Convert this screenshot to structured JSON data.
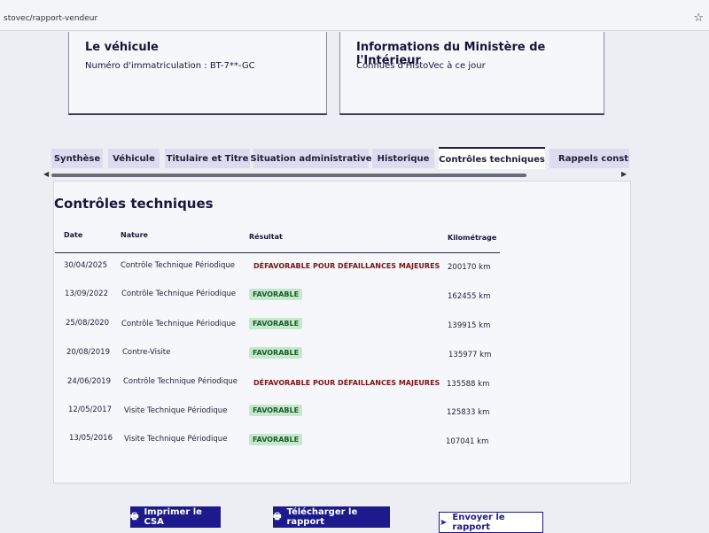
{
  "browser": {
    "url": "stovec/rapport-vendeur",
    "star_icon": "star-icon"
  },
  "vehicle_card": {
    "title": "Le véhicule",
    "text": "Numéro d'immatriculation : BT-7**-GC"
  },
  "ministry_card": {
    "title": "Informations du Ministère de l'Intérieur",
    "text": "Connues d'HistoVec à ce jour"
  },
  "tabs": [
    {
      "label": "Synthèse"
    },
    {
      "label": "Véhicule"
    },
    {
      "label": "Titulaire et Titre"
    },
    {
      "label": "Situation administrative"
    },
    {
      "label": "Historique"
    },
    {
      "label": "Contrôles techniques",
      "active": true
    },
    {
      "label": "Rappels constructeur"
    }
  ],
  "section": {
    "title": "Contrôles techniques"
  },
  "table": {
    "headers": {
      "date": "Date",
      "nature": "Nature",
      "result": "Résultat",
      "km": "Kilométrage"
    },
    "rows": [
      {
        "date": "30/04/2025",
        "nature": "Contrôle Technique Périodique",
        "result": "DÉFAVORABLE POUR DÉFAILLANCES MAJEURES",
        "km": "200170 km"
      },
      {
        "date": "13/09/2022",
        "nature": "Contrôle Technique Périodique",
        "result": "FAVORABLE",
        "km": "162455 km"
      },
      {
        "date": "25/08/2020",
        "nature": "Contrôle Technique Périodique",
        "result": "FAVORABLE",
        "km": "139915 km"
      },
      {
        "date": "20/08/2019",
        "nature": "Contre-Visite",
        "result": "FAVORABLE",
        "km": "135977 km"
      },
      {
        "date": "24/06/2019",
        "nature": "Contrôle Technique Périodique",
        "result": "DÉFAVORABLE POUR DÉFAILLANCES MAJEURES",
        "km": "135588 km"
      },
      {
        "date": "12/05/2017",
        "nature": "Visite Technique Périodique",
        "result": "FAVORABLE",
        "km": "125833 km"
      },
      {
        "date": "13/05/2016",
        "nature": "Visite Technique Périodique",
        "result": "FAVORABLE",
        "km": "107041 km"
      }
    ]
  },
  "colors": {
    "favorable_bg": "#c4e8cc",
    "favorable_text": "#1e5a2a",
    "defavorable_text": "#7a1414",
    "primary": "#1c1a8c"
  },
  "actions": {
    "print": {
      "label": "Imprimer le CSA",
      "icon": "printer-icon"
    },
    "download": {
      "label": "Télécharger le rapport",
      "icon": "printer-icon"
    },
    "send": {
      "label": "Envoyer le rapport",
      "icon": "send-icon"
    }
  }
}
